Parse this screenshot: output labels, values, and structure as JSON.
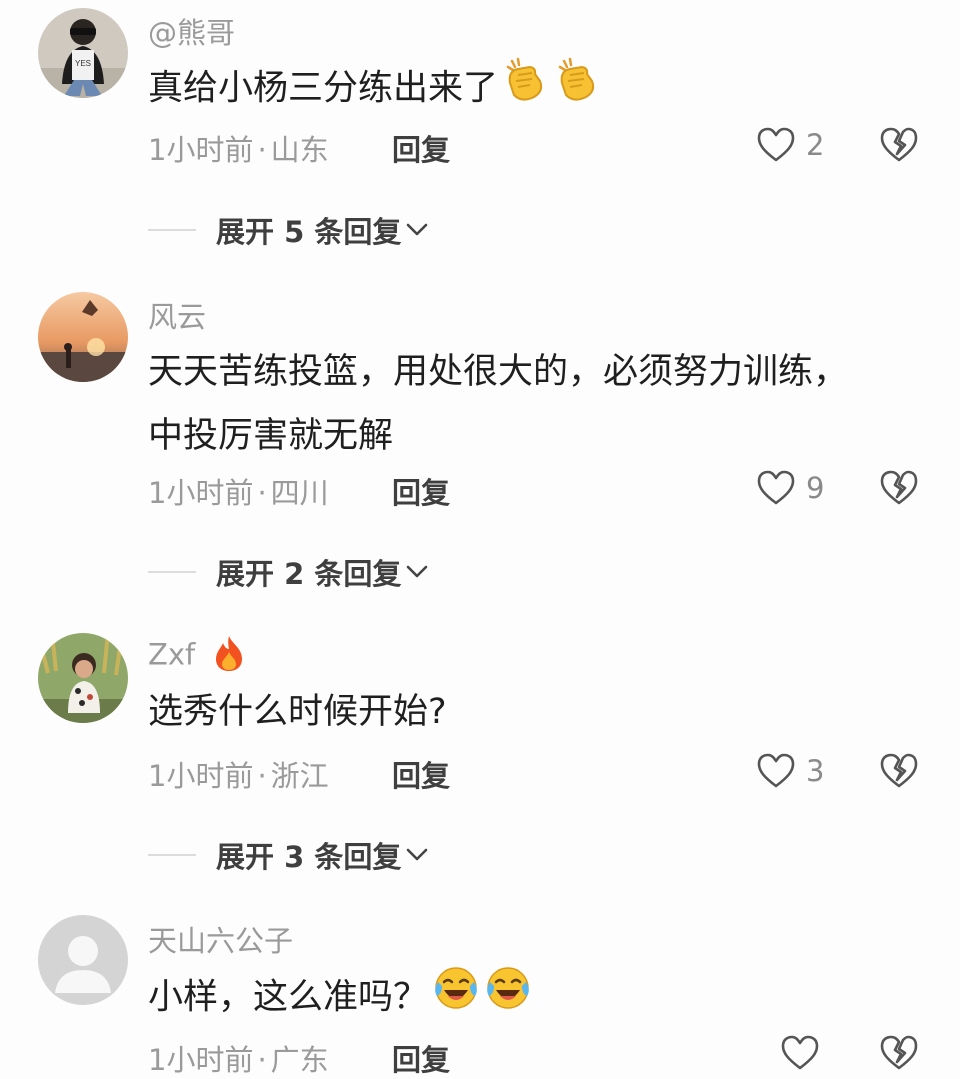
{
  "comments": [
    {
      "username": "@熊哥",
      "text_lines": [
        "真给小杨三分练出来了"
      ],
      "emoji_icons": [
        "clapping-hands-icon",
        "clapping-hands-icon"
      ],
      "time": "1小时前",
      "location": "山东",
      "reply_label": "回复",
      "like_count": "2",
      "expand_label": "展开 5 条回复",
      "avatar_text": "YES"
    },
    {
      "username": "风云",
      "text_lines": [
        "天天苦练投篮，用处很大的，必须努力训练，",
        "中投厉害就无解"
      ],
      "time": "1小时前",
      "location": "四川",
      "reply_label": "回复",
      "like_count": "9",
      "expand_label": "展开 2 条回复"
    },
    {
      "username": "Zxf",
      "badge_icon": "fire-icon",
      "text_lines": [
        "选秀什么时候开始?"
      ],
      "time": "1小时前",
      "location": "浙江",
      "reply_label": "回复",
      "like_count": "3",
      "expand_label": "展开 3 条回复"
    },
    {
      "username": "天山六公子",
      "text_lines": [
        "小样，这么准吗？"
      ],
      "emoji_icons": [
        "laughing-crying-face-icon",
        "laughing-crying-face-icon"
      ],
      "time": "1小时前",
      "location": "广东",
      "reply_label": "回复",
      "like_count": ""
    }
  ],
  "meta_separator": "·",
  "colors": {
    "background": "#fdfdfd",
    "secondary_text": "#9a9a9a",
    "primary_text": "#1f1f1f"
  }
}
